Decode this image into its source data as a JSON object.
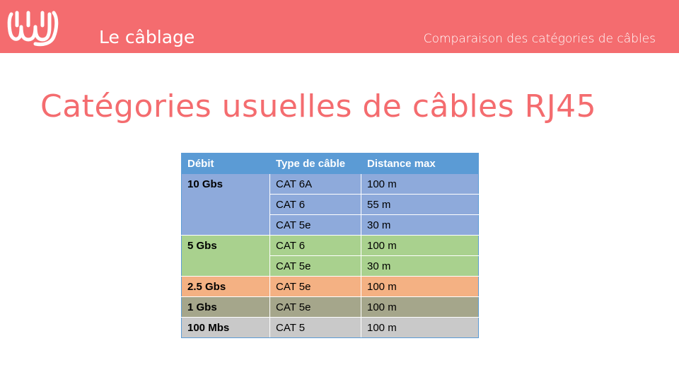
{
  "header": {
    "section_title": "Le câblage",
    "subtitle": "Comparaison des catégories de câbles",
    "logo_icon": "wavy-u-logo-icon",
    "accent_color": "#f46c6f"
  },
  "slide": {
    "title": "Catégories usuelles de câbles RJ45"
  },
  "table": {
    "headers": [
      "Débit",
      "Type de câble",
      "Distance max"
    ],
    "groups": [
      {
        "rate": "10 Gbs",
        "color": "#8eaadb",
        "rows": [
          {
            "cable": "CAT 6A",
            "distance": "100 m"
          },
          {
            "cable": "CAT 6",
            "distance": "55 m"
          },
          {
            "cable": "CAT 5e",
            "distance": "30 m"
          }
        ]
      },
      {
        "rate": "5 Gbs",
        "color": "#a9d18e",
        "rows": [
          {
            "cable": "CAT 6",
            "distance": "100 m"
          },
          {
            "cable": "CAT 5e",
            "distance": "30 m"
          }
        ]
      },
      {
        "rate": "2.5 Gbs",
        "color": "#f4b183",
        "rows": [
          {
            "cable": "CAT 5e",
            "distance": "100 m"
          }
        ]
      },
      {
        "rate": "1 Gbs",
        "color": "#a5a68b",
        "rows": [
          {
            "cable": "CAT 5e",
            "distance": "100 m"
          }
        ]
      },
      {
        "rate": "100 Mbs",
        "color": "#c9c9c9",
        "rows": [
          {
            "cable": "CAT 5",
            "distance": "100 m"
          }
        ]
      }
    ]
  }
}
